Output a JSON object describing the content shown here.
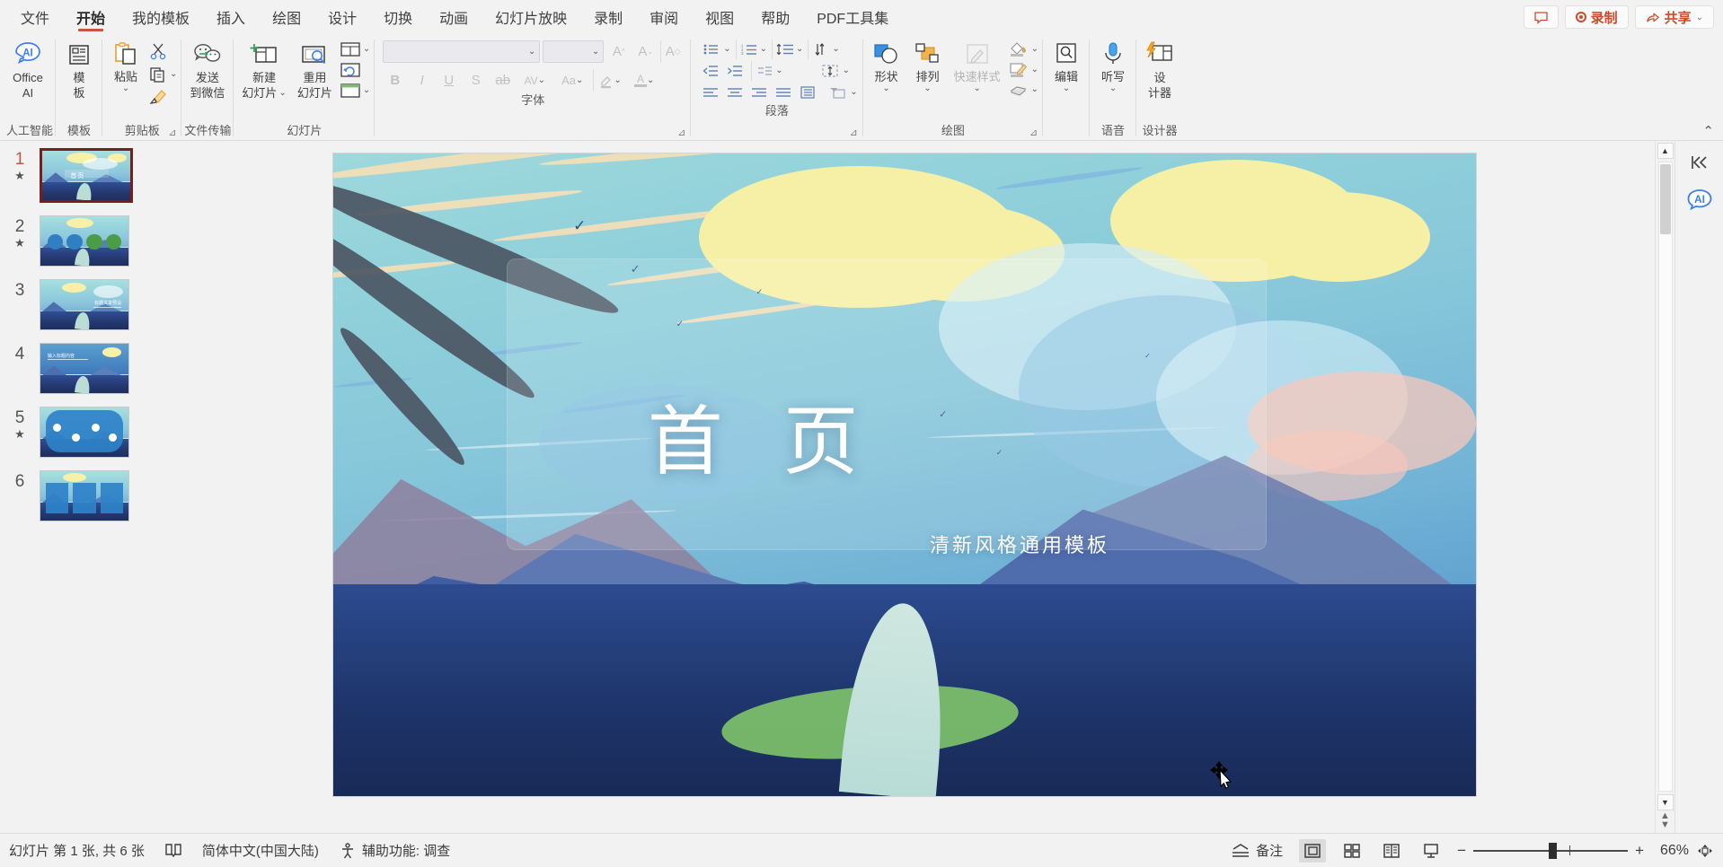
{
  "app": {
    "menu_tabs": [
      {
        "label": "文件",
        "active": false
      },
      {
        "label": "开始",
        "active": true
      },
      {
        "label": "我的模板",
        "active": false
      },
      {
        "label": "插入",
        "active": false
      },
      {
        "label": "绘图",
        "active": false
      },
      {
        "label": "设计",
        "active": false
      },
      {
        "label": "切换",
        "active": false
      },
      {
        "label": "动画",
        "active": false
      },
      {
        "label": "幻灯片放映",
        "active": false
      },
      {
        "label": "录制",
        "active": false
      },
      {
        "label": "审阅",
        "active": false
      },
      {
        "label": "视图",
        "active": false
      },
      {
        "label": "帮助",
        "active": false
      },
      {
        "label": "PDF工具集",
        "active": false
      }
    ],
    "titlebar_right": {
      "comment_icon": "comment-icon",
      "record_label": "录制",
      "share_label": "共享",
      "share_caret": "⌄",
      "accent_color": "#d04a2a"
    }
  },
  "ribbon": {
    "groups": [
      {
        "name": "人工智能",
        "label": "人工智能",
        "buttons": [
          {
            "label_line1": "Office",
            "label_line2": "AI",
            "icon": "office-ai-icon"
          }
        ]
      },
      {
        "name": "模板",
        "label": "模板",
        "buttons": [
          {
            "label_line1": "模",
            "label_line2": "板",
            "icon": "template-icon"
          }
        ]
      },
      {
        "name": "剪贴板",
        "label": "剪贴板",
        "buttons": [
          {
            "label_line1": "粘贴",
            "label_line2": "",
            "icon": "paste-icon",
            "caret": "⌄"
          }
        ],
        "small_buttons": [
          {
            "icon": "cut-scissors-icon",
            "label": ""
          },
          {
            "icon": "copy-icon",
            "label": "",
            "caret": "⌄"
          },
          {
            "icon": "format-painter-icon",
            "label": ""
          }
        ],
        "dialog_launcher": "⊿"
      },
      {
        "name": "文件传输",
        "label": "文件传输",
        "buttons": [
          {
            "label_line1": "发送",
            "label_line2": "到微信",
            "icon": "wechat-send-icon"
          }
        ]
      },
      {
        "name": "幻灯片",
        "label": "幻灯片",
        "buttons": [
          {
            "label_line1": "新建",
            "label_line2": "幻灯片",
            "icon": "new-slide-icon",
            "caret": "⌄"
          },
          {
            "label_line1": "重用",
            "label_line2": "幻灯片",
            "icon": "reuse-slide-icon"
          }
        ],
        "small_buttons": [
          {
            "icon": "slide-layout-icon",
            "caret": "⌄"
          },
          {
            "icon": "slide-reset-icon"
          },
          {
            "icon": "slide-section-icon",
            "caret": "⌄"
          }
        ]
      },
      {
        "name": "字体",
        "label": "字体",
        "font_name_value": "",
        "font_size_value": "",
        "disabled": true,
        "row1": [
          {
            "icon": "font-grow-icon",
            "glyph": "A"
          },
          {
            "icon": "font-shrink-icon",
            "glyph": "A"
          },
          {
            "icon": "clear-format-icon",
            "glyph": "A"
          }
        ],
        "row2": [
          {
            "icon": "bold-icon",
            "glyph": "B"
          },
          {
            "icon": "italic-icon",
            "glyph": "I"
          },
          {
            "icon": "underline-icon",
            "glyph": "U"
          },
          {
            "icon": "shadow-icon",
            "glyph": "S"
          },
          {
            "icon": "strikethrough-icon",
            "glyph": "ab"
          },
          {
            "icon": "character-spacing-icon",
            "glyph": "AV",
            "caret": "⌄"
          },
          {
            "icon": "change-case-icon",
            "glyph": "Aa",
            "caret": "⌄"
          },
          {
            "icon": "text-highlight-icon",
            "caret": "⌄"
          },
          {
            "icon": "font-color-icon",
            "glyph": "A",
            "caret": "⌄"
          }
        ],
        "dialog_launcher": "⊿"
      },
      {
        "name": "段落",
        "label": "段落",
        "row1": [
          {
            "icon": "bullets-icon",
            "caret": "⌄"
          },
          {
            "icon": "numbering-icon",
            "caret": "⌄"
          },
          {
            "icon": "line-spacing-icon",
            "caret": "⌄"
          },
          {
            "icon": "text-direction-vertical-icon",
            "caret": "⌄"
          }
        ],
        "row2": [
          {
            "icon": "decrease-indent-icon"
          },
          {
            "icon": "increase-indent-icon"
          },
          {
            "icon": "text-direction-icon",
            "caret": "⌄"
          },
          {
            "icon": "align-text-icon",
            "caret": "⌄"
          }
        ],
        "row3": [
          {
            "icon": "align-left-icon"
          },
          {
            "icon": "align-center-icon"
          },
          {
            "icon": "align-right-icon"
          },
          {
            "icon": "justify-icon"
          },
          {
            "icon": "distribute-icon"
          },
          {
            "icon": "convert-smartart-icon",
            "caret": "⌄"
          }
        ],
        "dialog_launcher": "⊿"
      },
      {
        "name": "绘图",
        "label": "绘图",
        "buttons": [
          {
            "label_line1": "形状",
            "icon": "shapes-icon",
            "caret": "⌄"
          },
          {
            "label_line1": "排列",
            "icon": "arrange-icon",
            "caret": "⌄"
          },
          {
            "label_line1": "快速样式",
            "icon": "quick-styles-icon",
            "caret": "⌄",
            "disabled": true
          }
        ],
        "small_buttons": [
          {
            "icon": "shape-fill-icon",
            "caret": "⌄"
          },
          {
            "icon": "shape-outline-icon",
            "caret": "⌄"
          },
          {
            "icon": "shape-effects-icon",
            "caret": "⌄"
          }
        ],
        "dialog_launcher": "⊿"
      },
      {
        "name": "编辑",
        "label": "",
        "buttons": [
          {
            "label_line1": "编辑",
            "icon": "find-edit-icon",
            "caret": "⌄"
          }
        ]
      },
      {
        "name": "语音",
        "label": "语音",
        "buttons": [
          {
            "label_line1": "听写",
            "icon": "dictate-mic-icon",
            "caret": "⌄"
          }
        ]
      },
      {
        "name": "设计器",
        "label": "设计器",
        "buttons": [
          {
            "label_line1": "设",
            "label_line2": "计器",
            "icon": "designer-icon"
          }
        ]
      }
    ],
    "collapse_icon": "chevron-up-icon"
  },
  "thumbnails": [
    {
      "number": "1",
      "starred": true,
      "selected": true,
      "kind": "title"
    },
    {
      "number": "2",
      "starred": true,
      "selected": false,
      "kind": "circles"
    },
    {
      "number": "3",
      "starred": false,
      "selected": false,
      "kind": "right-text"
    },
    {
      "number": "4",
      "starred": false,
      "selected": false,
      "kind": "left-text"
    },
    {
      "number": "5",
      "starred": true,
      "selected": false,
      "kind": "timeline"
    },
    {
      "number": "6",
      "starred": false,
      "selected": false,
      "kind": "cards"
    }
  ],
  "slide": {
    "title": "首 页",
    "subtitle": "清新风格通用模板",
    "cursor": "move-cursor"
  },
  "right_rail": {
    "collapse_icon": "collapse-panel-icon",
    "collapse_glyph": "⟨⟨",
    "ai_icon": "ai-bubble-icon",
    "ai_text": "AI"
  },
  "scrollbar": {
    "up_glyph": "▲",
    "down_glyph": "▼",
    "prev_slide_glyph": "▲",
    "next_slide_glyph": "▼"
  },
  "statusbar": {
    "slide_count_text": "幻灯片 第 1 张, 共 6 张",
    "book_icon": "word-count-icon",
    "language_text": "简体中文(中国大陆)",
    "accessibility_icon": "accessibility-icon",
    "accessibility_text": "辅助功能: 调查",
    "notes_icon": "notes-icon",
    "notes_label": "备注",
    "views": [
      {
        "icon": "normal-view-icon",
        "active": true
      },
      {
        "icon": "slide-sorter-icon",
        "active": false
      },
      {
        "icon": "reading-view-icon",
        "active": false
      },
      {
        "icon": "slideshow-icon",
        "active": false
      }
    ],
    "zoom_out_glyph": "−",
    "zoom_in_glyph": "+",
    "zoom_value": "66%",
    "fit_icon": "fit-to-window-icon"
  }
}
